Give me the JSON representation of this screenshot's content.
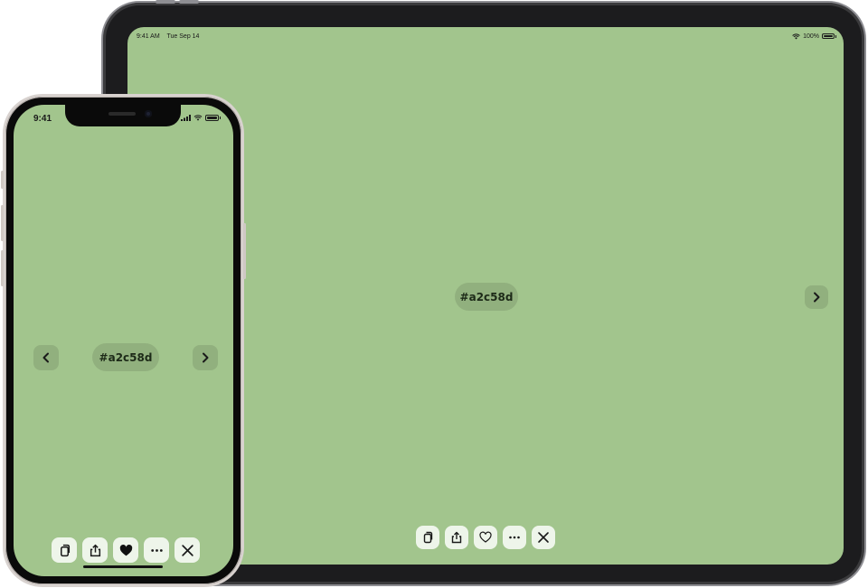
{
  "colors": {
    "background": "#a2c58d",
    "ipad_bezel": "#1c1c1e",
    "iphone_bezel": "#0a0a0a",
    "iphone_frame": "#d8d2cf",
    "text_dark": "#1d2a18"
  },
  "ipad": {
    "status": {
      "time": "9:41 AM",
      "date": "Tue Sep 14",
      "battery_text": "100%"
    },
    "hex_label": "#a2c58d",
    "next_icon": "chevron-right-icon",
    "toolbar": [
      "copy-icon",
      "share-icon",
      "heart-outline-icon",
      "more-icon",
      "close-icon"
    ]
  },
  "iphone": {
    "status": {
      "time": "9:41"
    },
    "hex_label": "#a2c58d",
    "prev_icon": "chevron-left-icon",
    "next_icon": "chevron-right-icon",
    "toolbar": [
      "copy-icon",
      "share-icon",
      "heart-filled-icon",
      "more-icon",
      "close-icon"
    ]
  }
}
